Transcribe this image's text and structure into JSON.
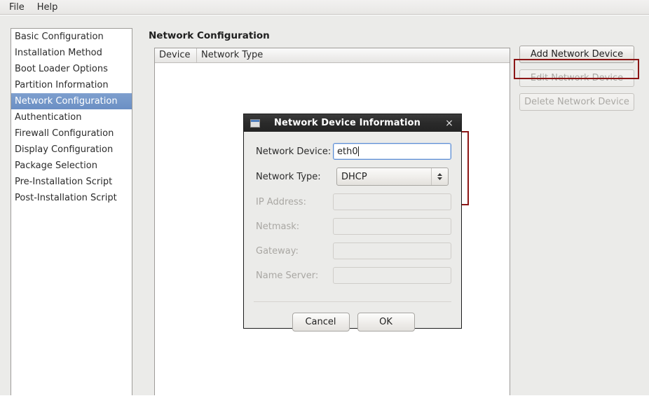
{
  "menubar": {
    "items": [
      {
        "label": "File"
      },
      {
        "label": "Help"
      }
    ]
  },
  "sidebar": {
    "items": [
      {
        "label": "Basic Configuration",
        "selected": false
      },
      {
        "label": "Installation Method",
        "selected": false
      },
      {
        "label": "Boot Loader Options",
        "selected": false
      },
      {
        "label": "Partition Information",
        "selected": false
      },
      {
        "label": "Network Configuration",
        "selected": true
      },
      {
        "label": "Authentication",
        "selected": false
      },
      {
        "label": "Firewall Configuration",
        "selected": false
      },
      {
        "label": "Display Configuration",
        "selected": false
      },
      {
        "label": "Package Selection",
        "selected": false
      },
      {
        "label": "Pre-Installation Script",
        "selected": false
      },
      {
        "label": "Post-Installation Script",
        "selected": false
      }
    ]
  },
  "main": {
    "title": "Network Configuration",
    "table": {
      "columns": [
        "Device",
        "Network Type"
      ],
      "rows": []
    },
    "buttons": [
      {
        "label": "Add Network Device",
        "enabled": true
      },
      {
        "label": "Edit Network Device",
        "enabled": false
      },
      {
        "label": "Delete Network Device",
        "enabled": false
      }
    ]
  },
  "dialog": {
    "title": "Network Device Information",
    "close_label": "×",
    "fields": [
      {
        "label": "Network Device:",
        "value": "eth0",
        "enabled": true,
        "type": "text"
      },
      {
        "label": "Network Type:",
        "value": "DHCP",
        "enabled": true,
        "type": "select"
      },
      {
        "label": "IP Address:",
        "value": "",
        "enabled": false,
        "type": "text"
      },
      {
        "label": "Netmask:",
        "value": "",
        "enabled": false,
        "type": "text"
      },
      {
        "label": "Gateway:",
        "value": "",
        "enabled": false,
        "type": "text"
      },
      {
        "label": "Name Server:",
        "value": "",
        "enabled": false,
        "type": "text"
      }
    ],
    "buttons": [
      {
        "label": "Cancel"
      },
      {
        "label": "OK"
      }
    ]
  },
  "colors": {
    "selection_blue": "#7396c8",
    "annotation_red": "#8c1616",
    "window_background": "#ebebe9",
    "titlebar_dark": "#2a2a2a"
  }
}
